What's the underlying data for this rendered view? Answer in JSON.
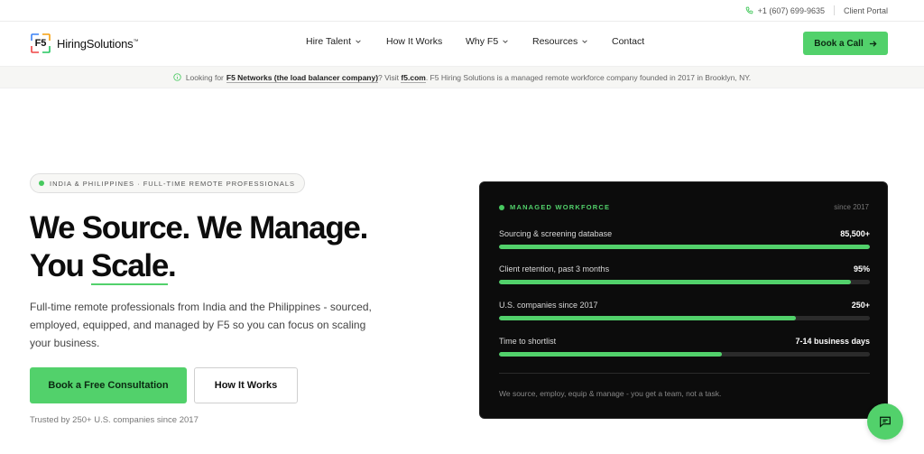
{
  "topbar": {
    "phone": "+1 (607) 699-9635",
    "client_portal": "Client Portal"
  },
  "brand": {
    "mark": "F5",
    "name": "HiringSolutions",
    "tm": "™"
  },
  "nav": {
    "items": [
      {
        "label": "Hire Talent",
        "has_dropdown": true
      },
      {
        "label": "How It Works",
        "has_dropdown": false
      },
      {
        "label": "Why F5",
        "has_dropdown": true
      },
      {
        "label": "Resources",
        "has_dropdown": true
      },
      {
        "label": "Contact",
        "has_dropdown": false
      }
    ],
    "cta": "Book a Call"
  },
  "notice": {
    "prefix": "Looking for",
    "link1": "F5 Networks (the load balancer company)",
    "middle": "? Visit",
    "link2": "f5.com",
    "suffix": ". F5 Hiring Solutions is a managed remote workforce company founded in 2017 in Brooklyn, NY."
  },
  "hero": {
    "pill": "INDIA & PHILIPPINES · FULL-TIME REMOTE PROFESSIONALS",
    "headline_line1": "We Source. We Manage.",
    "headline_line2_a": "You ",
    "headline_line2_b": "Scale",
    "headline_line2_c": ".",
    "lede": "Full-time remote professionals from India and the Philippines - sourced, employed, equipped, and managed by F5 so you can focus on scaling your business.",
    "primary_cta": "Book a Free Consultation",
    "secondary_cta": "How It Works",
    "trust": "Trusted by 250+ U.S. companies since 2017"
  },
  "card": {
    "title": "MANAGED WORKFORCE",
    "since": "since 2017",
    "metrics": [
      {
        "label": "Sourcing & screening database",
        "value": "85,500+",
        "progress": 1.0
      },
      {
        "label": "Client retention, past 3 months",
        "value": "95%",
        "progress": 0.95
      },
      {
        "label": "U.S. companies since 2017",
        "value": "250+",
        "progress": 0.8
      },
      {
        "label": "Time to shortlist",
        "value": "7-14 business days",
        "progress": 0.6
      }
    ],
    "footer": "We source, employ, equip & manage - you get a team, not a task."
  },
  "colors": {
    "accent": "#52d16b",
    "card_bg": "#0c0c0c"
  },
  "icons": {
    "phone": "phone-icon",
    "info": "info-icon",
    "arrow": "arrow-right-icon",
    "chat": "chat-icon"
  }
}
